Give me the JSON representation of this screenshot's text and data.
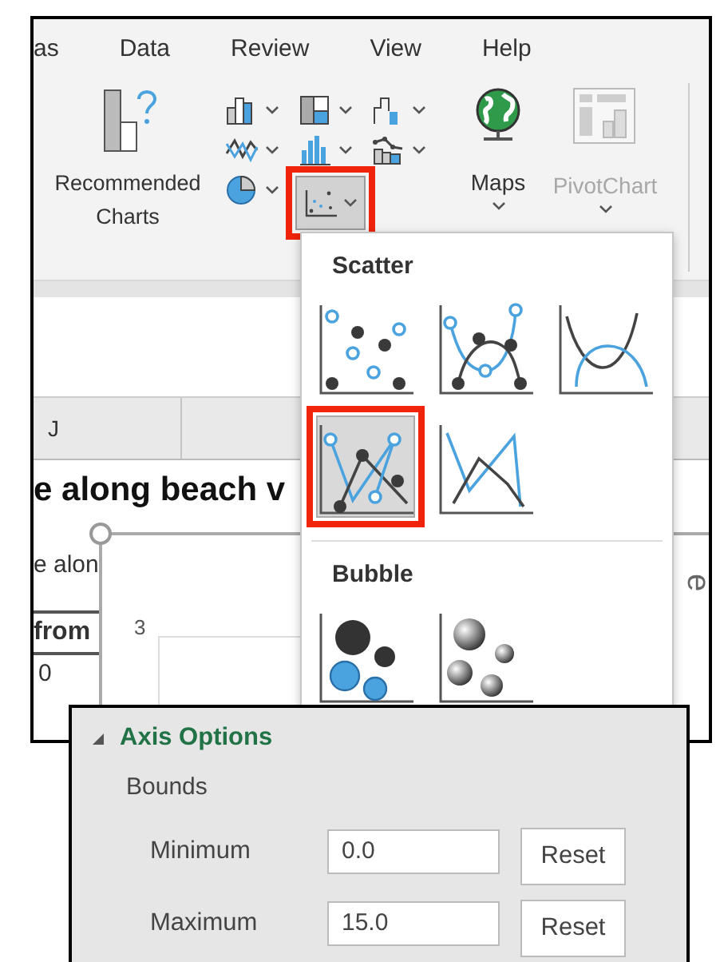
{
  "ribbon_tabs": [
    {
      "label": "as"
    },
    {
      "label": "Data"
    },
    {
      "label": "Review"
    },
    {
      "label": "View"
    },
    {
      "label": "Help"
    }
  ],
  "recommended_charts": {
    "label": "Recommended Charts"
  },
  "chart_type_buttons": [
    {
      "kind": "column",
      "selected": false
    },
    {
      "kind": "hierarchy",
      "selected": false
    },
    {
      "kind": "waterfall",
      "selected": false
    },
    {
      "kind": "line",
      "selected": false
    },
    {
      "kind": "statistic",
      "selected": false
    },
    {
      "kind": "combo",
      "selected": false
    },
    {
      "kind": "pie",
      "selected": false
    },
    {
      "kind": "scatter",
      "selected": true
    }
  ],
  "maps": {
    "label": "Maps"
  },
  "pivotchart": {
    "label": "PivotChart",
    "disabled": true
  },
  "sheet": {
    "column_header": "J",
    "title": "e along beach v",
    "subtitle": "e alon",
    "header_cell": "from",
    "cell": "0",
    "axis_tick": "3",
    "axis_title": "e"
  },
  "chart_menu": {
    "sections": [
      {
        "title": "Scatter",
        "items": [
          {
            "kind": "markers",
            "selected": false
          },
          {
            "kind": "smooth-markers",
            "selected": false
          },
          {
            "kind": "smooth",
            "selected": false
          },
          {
            "kind": "straight-markers",
            "selected": true
          },
          {
            "kind": "straight",
            "selected": false
          }
        ]
      },
      {
        "title": "Bubble",
        "items": [
          {
            "kind": "bubble",
            "selected": false
          },
          {
            "kind": "bubble-3d",
            "selected": false
          }
        ]
      }
    ]
  },
  "axis_panel": {
    "title": "Axis Options",
    "expanded": true,
    "group": "Bounds",
    "fields": [
      {
        "label": "Minimum",
        "value": "0.0",
        "button": "Reset"
      },
      {
        "label": "Maximum",
        "value": "15.0",
        "button": "Reset"
      }
    ]
  }
}
